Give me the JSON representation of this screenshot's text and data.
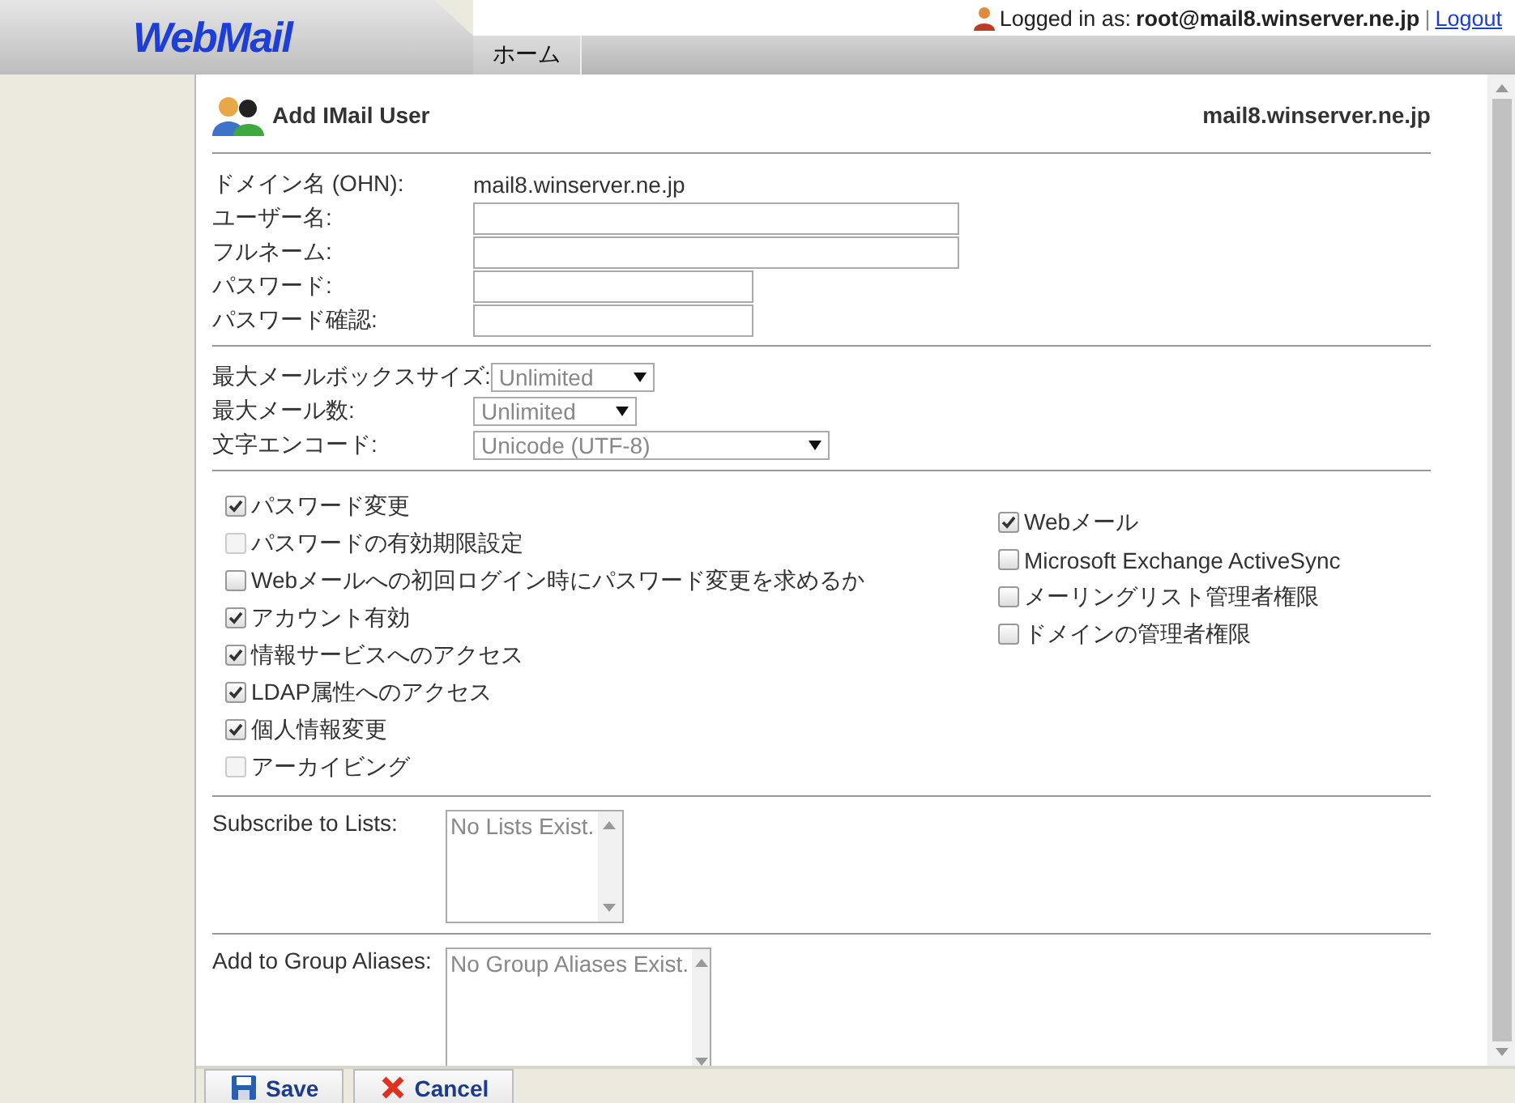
{
  "header": {
    "logo": "WebMail",
    "login_label": "Logged in as:",
    "user": "root@mail8.winserver.ne.jp",
    "separator": "|",
    "logout": "Logout",
    "tabs": [
      {
        "label": "ホーム",
        "selected": true
      }
    ]
  },
  "page": {
    "title": "Add IMail User",
    "domain": "mail8.winserver.ne.jp"
  },
  "account_fields": [
    {
      "label": "ドメイン名 (OHN):",
      "kind": "text",
      "value": "mail8.winserver.ne.jp"
    },
    {
      "label": "ユーザー名:",
      "kind": "wide"
    },
    {
      "label": "フルネーム:",
      "kind": "wide"
    },
    {
      "label": "パスワード:",
      "kind": "narrow"
    },
    {
      "label": "パスワード確認:",
      "kind": "narrow"
    }
  ],
  "limit_fields": [
    {
      "label": "最大メールボックスサイズ:",
      "kind": "short",
      "value": "Unlimited"
    },
    {
      "label": "最大メール数:",
      "kind": "short",
      "value": "Unlimited"
    },
    {
      "label": "文字エンコード:",
      "kind": "long",
      "value": "Unicode (UTF-8)"
    }
  ],
  "options_left": [
    {
      "label": "パスワード変更",
      "checked": true,
      "disabled": false
    },
    {
      "label": "パスワードの有効期限設定",
      "checked": false,
      "disabled": true
    },
    {
      "label": "Webメールへの初回ログイン時にパスワード変更を求めるか",
      "checked": false,
      "disabled": false
    },
    {
      "label": "アカウント有効",
      "checked": true,
      "disabled": false
    },
    {
      "label": "情報サービスへのアクセス",
      "checked": true,
      "disabled": false
    },
    {
      "label": "LDAP属性へのアクセス",
      "checked": true,
      "disabled": false
    },
    {
      "label": "個人情報変更",
      "checked": true,
      "disabled": false
    },
    {
      "label": "アーカイビング",
      "checked": false,
      "disabled": true
    }
  ],
  "options_right": [
    {
      "label": "Webメール",
      "checked": true,
      "disabled": false
    },
    {
      "label": "Microsoft Exchange ActiveSync",
      "checked": false,
      "disabled": false
    },
    {
      "label": "メーリングリスト管理者権限",
      "checked": false,
      "disabled": false
    },
    {
      "label": "ドメインの管理者権限",
      "checked": false,
      "disabled": false
    }
  ],
  "memberships": [
    {
      "label": "Subscribe to Lists:",
      "kind": "small",
      "item": "No Lists Exist."
    },
    {
      "label": "Add to Group Aliases:",
      "kind": "large",
      "item": "No Group Aliases Exist."
    }
  ],
  "buttons": [
    {
      "label": "Save",
      "kind": "save"
    },
    {
      "label": "Cancel",
      "kind": "cancel"
    }
  ]
}
